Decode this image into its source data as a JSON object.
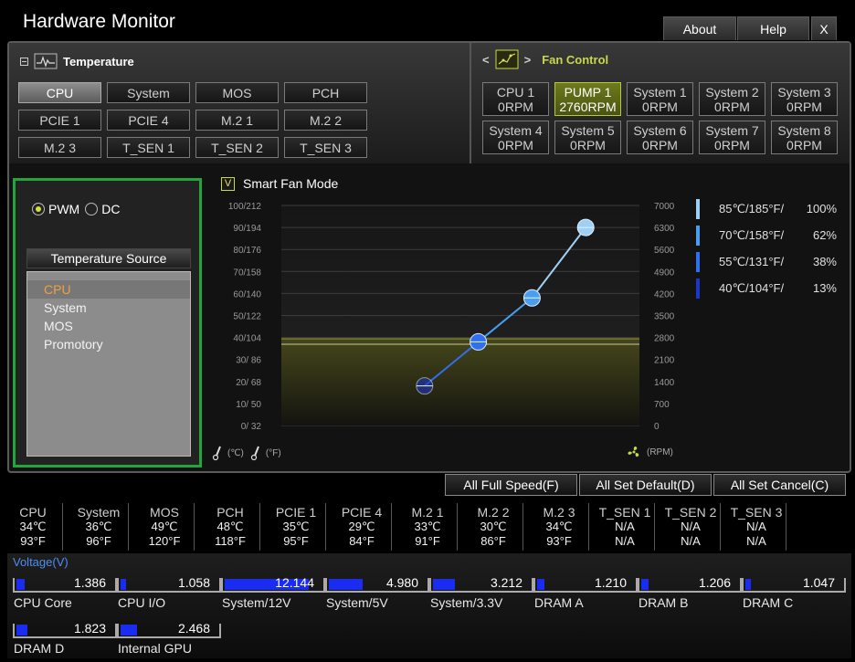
{
  "app": {
    "title": "Hardware Monitor",
    "buttons": {
      "about": "About",
      "help": "Help",
      "close": "X"
    }
  },
  "temperature": {
    "title": "Temperature",
    "sources": [
      "CPU",
      "System",
      "MOS",
      "PCH",
      "PCIE 1",
      "PCIE 4",
      "M.2 1",
      "M.2 2",
      "M.2 3",
      "T_SEN 1",
      "T_SEN 2",
      "T_SEN 3"
    ],
    "active": "CPU"
  },
  "fan_control": {
    "title": "Fan Control",
    "prev": "<",
    "next": ">",
    "fans": [
      {
        "name": "CPU 1",
        "rpm": "0RPM"
      },
      {
        "name": "PUMP 1",
        "rpm": "2760RPM"
      },
      {
        "name": "System 1",
        "rpm": "0RPM"
      },
      {
        "name": "System 2",
        "rpm": "0RPM"
      },
      {
        "name": "System 3",
        "rpm": "0RPM"
      },
      {
        "name": "System 4",
        "rpm": "0RPM"
      },
      {
        "name": "System 5",
        "rpm": "0RPM"
      },
      {
        "name": "System 6",
        "rpm": "0RPM"
      },
      {
        "name": "System 7",
        "rpm": "0RPM"
      },
      {
        "name": "System 8",
        "rpm": "0RPM"
      }
    ],
    "active": "PUMP 1"
  },
  "mode": {
    "pwm": "PWM",
    "dc": "DC",
    "selected": "PWM"
  },
  "temp_source": {
    "header": "Temperature Source",
    "items": [
      "CPU",
      "System",
      "MOS",
      "Promotory"
    ],
    "selected": "CPU"
  },
  "smart_fan": {
    "label": "Smart Fan Mode",
    "check": "V",
    "celsius_unit": "(℃)",
    "fahrenheit_unit": "(°F)",
    "rpm_unit": "(RPM)"
  },
  "chart_data": {
    "type": "line",
    "y_left_labels": [
      "100/212",
      "90/194",
      "80/176",
      "70/158",
      "60/140",
      "50/122",
      "40/104",
      "30/  86",
      "20/  68",
      "10/  50",
      "0/  32"
    ],
    "y_right_labels": [
      "7000",
      "6300",
      "5600",
      "4900",
      "4200",
      "3500",
      "2800",
      "2100",
      "1400",
      "700",
      "0"
    ],
    "ylim": [
      0,
      100
    ],
    "rpm_lim": [
      0,
      7000
    ],
    "curve_points": [
      {
        "temp": 40,
        "percent": 18
      },
      {
        "temp": 55,
        "percent": 38
      },
      {
        "temp": 70,
        "percent": 58
      },
      {
        "temp": 85,
        "percent": 90
      }
    ],
    "current_rpm": 2760,
    "grid": true
  },
  "legend": [
    {
      "temp": "85℃/185°F/",
      "pct": "100%",
      "color": "#9dd0f4"
    },
    {
      "temp": "70℃/158°F/",
      "pct": "62%",
      "color": "#4a9ef0"
    },
    {
      "temp": "55℃/131°F/",
      "pct": "38%",
      "color": "#2f6ff0"
    },
    {
      "temp": "40℃/104°F/",
      "pct": "13%",
      "color": "#1c36c8"
    }
  ],
  "actions": {
    "full_speed": "All Full Speed(F)",
    "set_default": "All Set Default(D)",
    "set_cancel": "All Set Cancel(C)"
  },
  "temps": [
    {
      "name": "CPU",
      "c": "34℃",
      "f": "93°F"
    },
    {
      "name": "System",
      "c": "36℃",
      "f": "96°F"
    },
    {
      "name": "MOS",
      "c": "49℃",
      "f": "120°F"
    },
    {
      "name": "PCH",
      "c": "48℃",
      "f": "118°F"
    },
    {
      "name": "PCIE 1",
      "c": "35℃",
      "f": "95°F"
    },
    {
      "name": "PCIE 4",
      "c": "29℃",
      "f": "84°F"
    },
    {
      "name": "M.2 1",
      "c": "33℃",
      "f": "91°F"
    },
    {
      "name": "M.2 2",
      "c": "30℃",
      "f": "86°F"
    },
    {
      "name": "M.2 3",
      "c": "34℃",
      "f": "93°F"
    },
    {
      "name": "T_SEN 1",
      "c": "N/A",
      "f": "N/A"
    },
    {
      "name": "T_SEN 2",
      "c": "N/A",
      "f": "N/A"
    },
    {
      "name": "T_SEN 3",
      "c": "N/A",
      "f": "N/A"
    }
  ],
  "voltage": {
    "title": "Voltage(V)",
    "items": [
      {
        "name": "CPU Core",
        "value": "1.386",
        "level": 0.08
      },
      {
        "name": "CPU I/O",
        "value": "1.058",
        "level": 0.06
      },
      {
        "name": "System/12V",
        "value": "12.144",
        "level": 0.85
      },
      {
        "name": "System/5V",
        "value": "4.980",
        "level": 0.34
      },
      {
        "name": "System/3.3V",
        "value": "3.212",
        "level": 0.22
      },
      {
        "name": "DRAM A",
        "value": "1.210",
        "level": 0.07
      },
      {
        "name": "DRAM B",
        "value": "1.206",
        "level": 0.07
      },
      {
        "name": "DRAM C",
        "value": "1.047",
        "level": 0.06
      },
      {
        "name": "DRAM D",
        "value": "1.823",
        "level": 0.11
      },
      {
        "name": "Internal GPU",
        "value": "2.468",
        "level": 0.17
      }
    ]
  }
}
